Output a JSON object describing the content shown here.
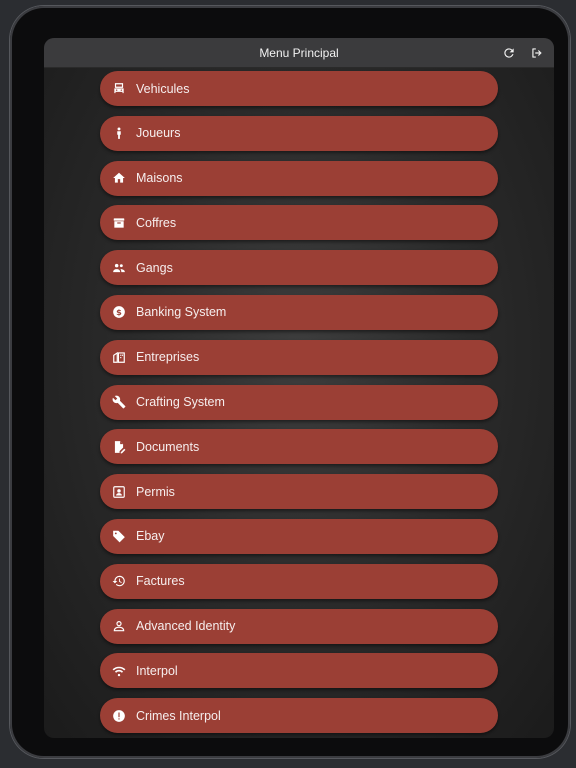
{
  "app": {
    "title": "Menu Principal",
    "actions": {
      "refresh_icon": "refresh-icon",
      "logout_icon": "logout-icon"
    }
  },
  "menu": {
    "items": [
      {
        "label": "Vehicules",
        "icon": "car-icon"
      },
      {
        "label": "Joueurs",
        "icon": "person-icon"
      },
      {
        "label": "Maisons",
        "icon": "home-icon"
      },
      {
        "label": "Coffres",
        "icon": "archive-box-icon"
      },
      {
        "label": "Gangs",
        "icon": "group-icon"
      },
      {
        "label": "Banking System",
        "icon": "dollar-coin-icon"
      },
      {
        "label": "Entreprises",
        "icon": "buildings-icon"
      },
      {
        "label": "Crafting System",
        "icon": "wrench-icon"
      },
      {
        "label": "Documents",
        "icon": "document-edit-icon"
      },
      {
        "label": "Permis",
        "icon": "id-card-icon"
      },
      {
        "label": "Ebay",
        "icon": "tag-icon"
      },
      {
        "label": "Factures",
        "icon": "history-icon"
      },
      {
        "label": "Advanced Identity",
        "icon": "user-outline-icon"
      },
      {
        "label": "Interpol",
        "icon": "wifi-signal-icon"
      },
      {
        "label": "Crimes Interpol",
        "icon": "alert-circle-icon"
      }
    ]
  },
  "colors": {
    "button_bg": "#9b3f35",
    "appbar_bg": "#3b3b3d",
    "text": "#f6eeee"
  }
}
